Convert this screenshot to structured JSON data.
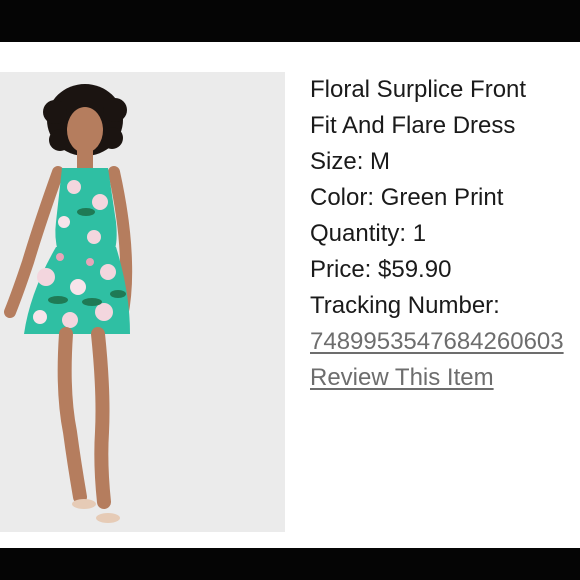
{
  "product": {
    "title_line1": "Floral Surplice Front",
    "title_line2": "Fit And Flare Dress",
    "size": "Size: M",
    "color": "Color: Green Print",
    "quantity": "Quantity: 1",
    "price": "Price: $59.90",
    "tracking_label": "Tracking Number:",
    "tracking_number": "748995354768426060​3",
    "review_link": "Review This Item"
  },
  "image": {
    "subject": "model-wearing-green-floral-dress",
    "background_color": "#ebebeb",
    "dress_color": "#2fbfa3"
  }
}
